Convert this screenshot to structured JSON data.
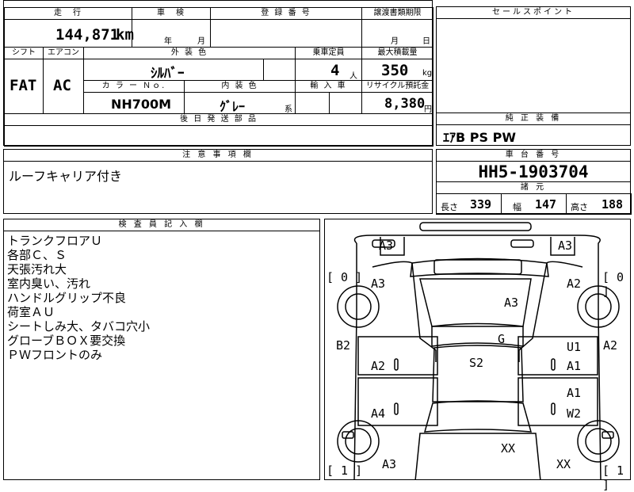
{
  "mileage": {
    "label": "走　行",
    "value": "144,871",
    "unit": "km"
  },
  "inspection": {
    "label": "車　検",
    "year_unit": "年",
    "month_unit": "月"
  },
  "registration": {
    "label": "登 録 番 号",
    "value": ""
  },
  "transfer": {
    "label": "譲渡書類期限",
    "month_unit": "月",
    "day_unit": "日"
  },
  "sales_point": {
    "label": "セールスポイント",
    "value": ""
  },
  "shift": {
    "label": "シフト",
    "value": "FAT"
  },
  "aircon": {
    "label": "エアコン",
    "value": "AC"
  },
  "exterior_color": {
    "label": "外 装 色",
    "value": "ｼﾙﾊﾞｰ"
  },
  "capacity": {
    "label": "乗車定員",
    "value": "4",
    "unit": "人"
  },
  "max_load": {
    "label": "最大積載量",
    "value": "350",
    "unit": "kg"
  },
  "color_no": {
    "label": "カ ラ ー Ｎｏ.",
    "value": "NH700M"
  },
  "interior_color": {
    "label": "内 装 色",
    "value": "ｸﾞﾚｰ",
    "suffix": "系"
  },
  "import": {
    "label": "輸 入 車",
    "value": ""
  },
  "recycle": {
    "label": "リサイクル預託金",
    "value": "8,380",
    "unit": "円"
  },
  "later_parts": {
    "label": "後 日 発 送 部 品",
    "value": ""
  },
  "genuine_equipment": {
    "label": "純 正 装 備",
    "value": "ｴｱB PS PW"
  },
  "caution": {
    "label": "注 意 事 項 欄",
    "value": "ルーフキャリア付き"
  },
  "chassis": {
    "label": "車 台 番 号",
    "value": "HH5-1903704"
  },
  "specs": {
    "label": "諸 元",
    "length_label": "長さ",
    "length": "339",
    "width_label": "幅",
    "width": "147",
    "height_label": "高さ",
    "height": "188"
  },
  "inspector_notes": {
    "label": "検 査 員 記 入 欄",
    "lines": [
      "トランクフロアＵ",
      "各部Ｃ、Ｓ",
      "天張汚れ大",
      "室内臭い、汚れ",
      "ハンドルグリップ不良",
      "荷室ＡＵ",
      "シートしみ大、タバコ穴小",
      "グローブＢＯＸ要交換",
      "ＰＷフロントのみ"
    ]
  },
  "diagram": {
    "codes": {
      "rear_left": "A3",
      "rear_right": "A3",
      "tire_rl": "[ 0 ]",
      "tire_rr": "[ 0 ]",
      "rear_quarter_l": "A3",
      "rear_quarter_r": "A2",
      "roof": "A3",
      "glass": "G",
      "roof_center": "S2",
      "rear_door_l_side": "B2",
      "rear_door_r_side": "A2",
      "rear_door_l": "A2",
      "rear_door_r_top": "U1",
      "rear_door_r_bottom": "A1",
      "front_door_l": "A4",
      "front_door_r_top": "A1",
      "front_door_r_bottom": "W2",
      "hood": "XX",
      "front_right": "XX",
      "front_left": "A3",
      "tire_fl": "[ 1 ]",
      "tire_fr": "[ 1 ]"
    }
  }
}
